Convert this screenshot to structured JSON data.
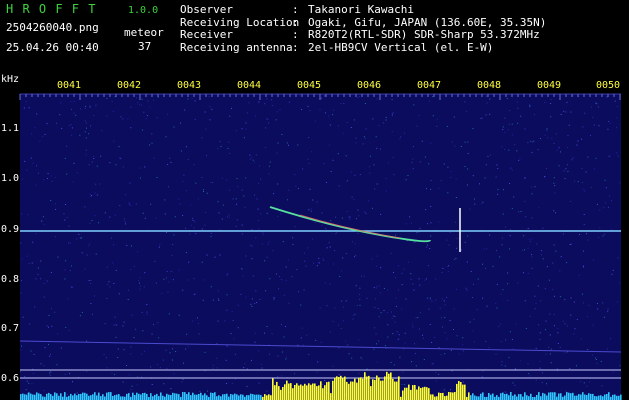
{
  "app": {
    "title": "H R O F F T",
    "version": "1.0.0",
    "filename": "2504260040.png",
    "timestamp": "25.04.26 00:40",
    "count_label": "meteor",
    "count_value": "37"
  },
  "info": [
    {
      "key": "Observer",
      "value": "Takanori Kawachi"
    },
    {
      "key": "Receiving Location",
      "value": "Ogaki, Gifu, JAPAN (136.60E, 35.35N)"
    },
    {
      "key": "Receiver",
      "value": "R820T2(RTL-SDR) SDR-Sharp 53.372MHz"
    },
    {
      "key": "Receiving antenna",
      "value": "2el-HB9CV Vertical (el. E-W)"
    }
  ],
  "axis": {
    "y_unit": "kHz",
    "y_labels": [
      "1.1",
      "1.0",
      "0.9",
      "0.8",
      "0.7",
      "0.6"
    ],
    "x_labels": [
      "0041",
      "0042",
      "0043",
      "0044",
      "0045",
      "0046",
      "0047",
      "0048",
      "0049",
      "0050"
    ]
  },
  "colors": {
    "background": "#000000",
    "spectrogram_bg": "#0c0c5e",
    "header_green": "#3ed33e",
    "tick_yellow": "#ffff40",
    "trace_line": "#7fd0ff",
    "histogram": "#ffff30"
  }
}
